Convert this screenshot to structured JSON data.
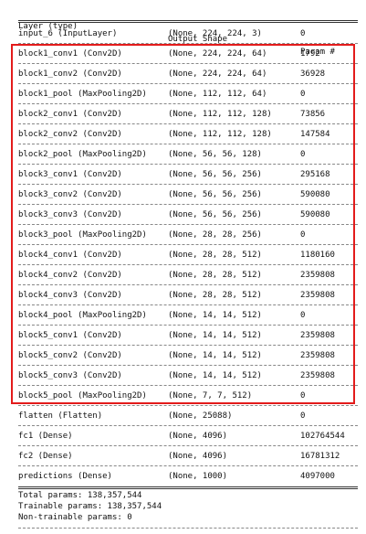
{
  "header": {
    "col_layer": "Layer (type)",
    "col_output": "Output Shape",
    "col_params": "Param #"
  },
  "rows": [
    {
      "layer": "input_6 (InputLayer)",
      "output": "(None, 224, 224, 3)",
      "params": "0"
    },
    {
      "layer": "block1_conv1 (Conv2D)",
      "output": "(None, 224, 224, 64)",
      "params": "1792"
    },
    {
      "layer": "block1_conv2 (Conv2D)",
      "output": "(None, 224, 224, 64)",
      "params": "36928"
    },
    {
      "layer": "block1_pool (MaxPooling2D)",
      "output": "(None, 112, 112, 64)",
      "params": "0"
    },
    {
      "layer": "block2_conv1 (Conv2D)",
      "output": "(None, 112, 112, 128)",
      "params": "73856"
    },
    {
      "layer": "block2_conv2 (Conv2D)",
      "output": "(None, 112, 112, 128)",
      "params": "147584"
    },
    {
      "layer": "block2_pool (MaxPooling2D)",
      "output": "(None, 56, 56, 128)",
      "params": "0"
    },
    {
      "layer": "block3_conv1 (Conv2D)",
      "output": "(None, 56, 56, 256)",
      "params": "295168"
    },
    {
      "layer": "block3_conv2 (Conv2D)",
      "output": "(None, 56, 56, 256)",
      "params": "590080"
    },
    {
      "layer": "block3_conv3 (Conv2D)",
      "output": "(None, 56, 56, 256)",
      "params": "590080"
    },
    {
      "layer": "block3_pool (MaxPooling2D)",
      "output": "(None, 28, 28, 256)",
      "params": "0"
    },
    {
      "layer": "block4_conv1 (Conv2D)",
      "output": "(None, 28, 28, 512)",
      "params": "1180160"
    },
    {
      "layer": "block4_conv2 (Conv2D)",
      "output": "(None, 28, 28, 512)",
      "params": "2359808"
    },
    {
      "layer": "block4_conv3 (Conv2D)",
      "output": "(None, 28, 28, 512)",
      "params": "2359808"
    },
    {
      "layer": "block4_pool (MaxPooling2D)",
      "output": "(None, 14, 14, 512)",
      "params": "0"
    },
    {
      "layer": "block5_conv1 (Conv2D)",
      "output": "(None, 14, 14, 512)",
      "params": "2359808"
    },
    {
      "layer": "block5_conv2 (Conv2D)",
      "output": "(None, 14, 14, 512)",
      "params": "2359808"
    },
    {
      "layer": "block5_conv3 (Conv2D)",
      "output": "(None, 14, 14, 512)",
      "params": "2359808"
    },
    {
      "layer": "block5_pool (MaxPooling2D)",
      "output": "(None, 7, 7, 512)",
      "params": "0"
    },
    {
      "layer": "flatten (Flatten)",
      "output": "(None, 25088)",
      "params": "0"
    },
    {
      "layer": "fc1 (Dense)",
      "output": "(None, 4096)",
      "params": "102764544"
    },
    {
      "layer": "fc2 (Dense)",
      "output": "(None, 4096)",
      "params": "16781312"
    },
    {
      "layer": "predictions (Dense)",
      "output": "(None, 1000)",
      "params": "4097000"
    }
  ],
  "summary": {
    "total": "Total params: 138,357,544",
    "trainable": "Trainable params: 138,357,544",
    "non_trainable": "Non-trainable params: 0"
  },
  "highlight_color": "#e31b1b"
}
